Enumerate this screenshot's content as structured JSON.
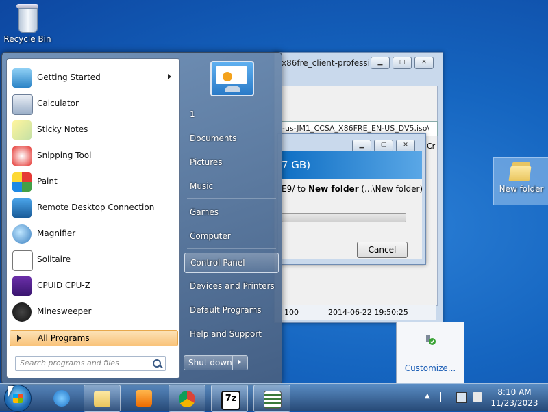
{
  "desktop": {
    "recycle_bin": "Recycle Bin",
    "new_folder": "New folder"
  },
  "back_window": {
    "title": "x86fre_client-professi...",
    "path": "-us-JM1_CCSA_X86FRE_EN-US_DV5.iso\\",
    "col_fragment": "Cr",
    "status_value": "100",
    "status_date": "2014-06-22 19:50:25"
  },
  "progress_dialog": {
    "header": "7 GB)",
    "message_prefix": "E9/ to ",
    "message_target": "New folder",
    "message_suffix": " (...\\New folder)",
    "cancel_label": "Cancel"
  },
  "tray_popup": {
    "customize_label": "Customize..."
  },
  "start_menu": {
    "programs": [
      {
        "label": "Getting Started",
        "icon": "getting-started-icon",
        "has_arrow": true
      },
      {
        "label": "Calculator",
        "icon": "calculator-icon"
      },
      {
        "label": "Sticky Notes",
        "icon": "sticky-notes-icon"
      },
      {
        "label": "Snipping Tool",
        "icon": "snipping-tool-icon"
      },
      {
        "label": "Paint",
        "icon": "paint-icon"
      },
      {
        "label": "Remote Desktop Connection",
        "icon": "remote-desktop-icon"
      },
      {
        "label": "Magnifier",
        "icon": "magnifier-icon"
      },
      {
        "label": "Solitaire",
        "icon": "solitaire-icon"
      },
      {
        "label": "CPUID CPU-Z",
        "icon": "cpuz-icon"
      },
      {
        "label": "Minesweeper",
        "icon": "minesweeper-icon"
      }
    ],
    "all_programs": "All Programs",
    "search_placeholder": "Search programs and files",
    "right_items": [
      {
        "label": "1"
      },
      {
        "label": "Documents"
      },
      {
        "label": "Pictures"
      },
      {
        "label": "Music"
      },
      {
        "label": "Games"
      },
      {
        "label": "Computer"
      },
      {
        "label": "Control Panel"
      },
      {
        "label": "Devices and Printers"
      },
      {
        "label": "Default Programs"
      },
      {
        "label": "Help and Support"
      }
    ],
    "shutdown_label": "Shut down"
  },
  "taskbar": {
    "apps": [
      "internet-explorer-icon",
      "file-explorer-icon",
      "media-player-icon",
      "chrome-icon",
      "7zip-icon",
      "notepad-list-icon"
    ],
    "time": "8:10 AM",
    "date": "11/23/2023"
  },
  "colors": {
    "desktop": "#1565c0",
    "highlight": "#f9c37a"
  }
}
